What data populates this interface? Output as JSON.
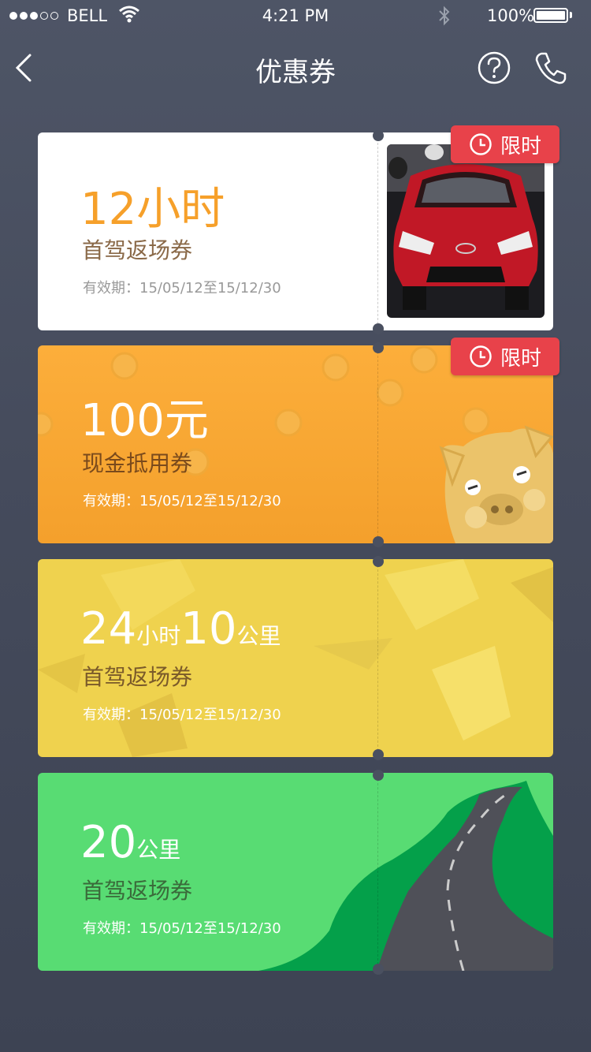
{
  "status_bar": {
    "carrier": "BELL",
    "time": "4:21 PM",
    "battery": "100%"
  },
  "nav": {
    "title": "优惠券",
    "icons": [
      "back-arrow-icon",
      "help-icon",
      "phone-icon"
    ]
  },
  "coupons": [
    {
      "value": "12小时",
      "type": "首驾返场券",
      "validity": "有效期：15/05/12至15/12/30",
      "badge": "限时"
    },
    {
      "value": "100元",
      "type": "现金抵用券",
      "validity": "有效期：15/05/12至15/12/30",
      "badge": "限时"
    },
    {
      "value_a": "24",
      "unit_a": "小时",
      "value_b": "10",
      "unit_b": "公里",
      "type": "首驾返场券",
      "validity": "有效期：15/05/12至15/12/30"
    },
    {
      "value": "20",
      "unit": "公里",
      "type": "首驾返场券",
      "validity": "有效期：15/05/12至15/12/30"
    }
  ],
  "colors": {
    "background": "#454b5c",
    "orange": "#f6a02a",
    "yellow": "#efd24e",
    "green": "#58dc73",
    "badge_red": "#e8424a"
  }
}
